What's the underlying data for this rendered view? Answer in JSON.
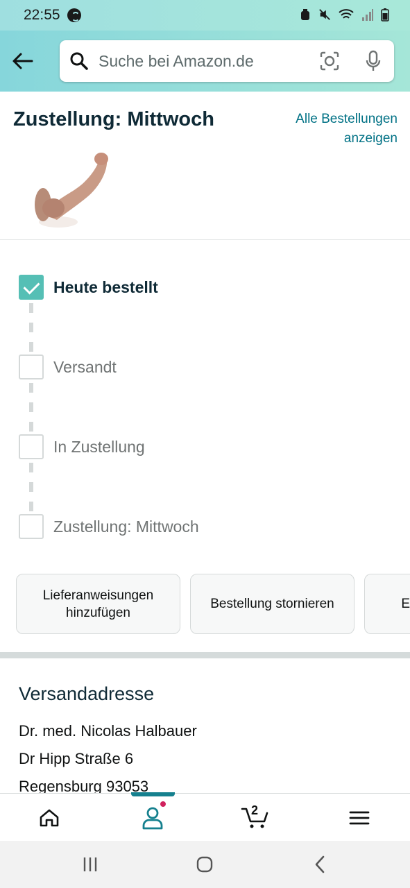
{
  "status_bar": {
    "time": "22:55",
    "icons": [
      "shazam-icon",
      "alarm-icon",
      "mute-icon",
      "wifi-icon",
      "signal-icon",
      "battery-icon"
    ]
  },
  "header": {
    "back_icon": "arrow-left-icon",
    "search_placeholder": "Suche bei Amazon.de",
    "camera_icon": "camera-icon",
    "mic_icon": "mic-icon"
  },
  "delivery": {
    "title": "Zustellung: Mittwoch",
    "all_orders_line1": "Alle Bestellungen",
    "all_orders_line2": "anzeigen"
  },
  "tracker": {
    "steps": [
      {
        "label": "Heute bestellt",
        "checked": true
      },
      {
        "label": "Versandt",
        "checked": false
      },
      {
        "label": "In Zustellung",
        "checked": false
      },
      {
        "label": "Zustellung: Mittwoch",
        "checked": false
      }
    ]
  },
  "actions": {
    "delivery_instructions_line1": "Lieferanweisungen",
    "delivery_instructions_line2": "hinzufügen",
    "cancel_order": "Bestellung stornieren",
    "third_partial": "E"
  },
  "address": {
    "title": "Versandadresse",
    "lines": [
      "Dr. med. Nicolas Halbauer",
      "Dr Hipp Straße 6",
      "Regensburg 93053"
    ]
  },
  "bottom_nav": {
    "items": [
      "home-icon",
      "account-icon",
      "cart-icon",
      "menu-icon"
    ],
    "cart_count": "2"
  },
  "colors": {
    "accent_teal": "#007185",
    "check_teal": "#55bfb5",
    "header_gradient_start": "#86d6db",
    "header_gradient_end": "#a5e6d8",
    "badge_pink": "#d0215d"
  }
}
